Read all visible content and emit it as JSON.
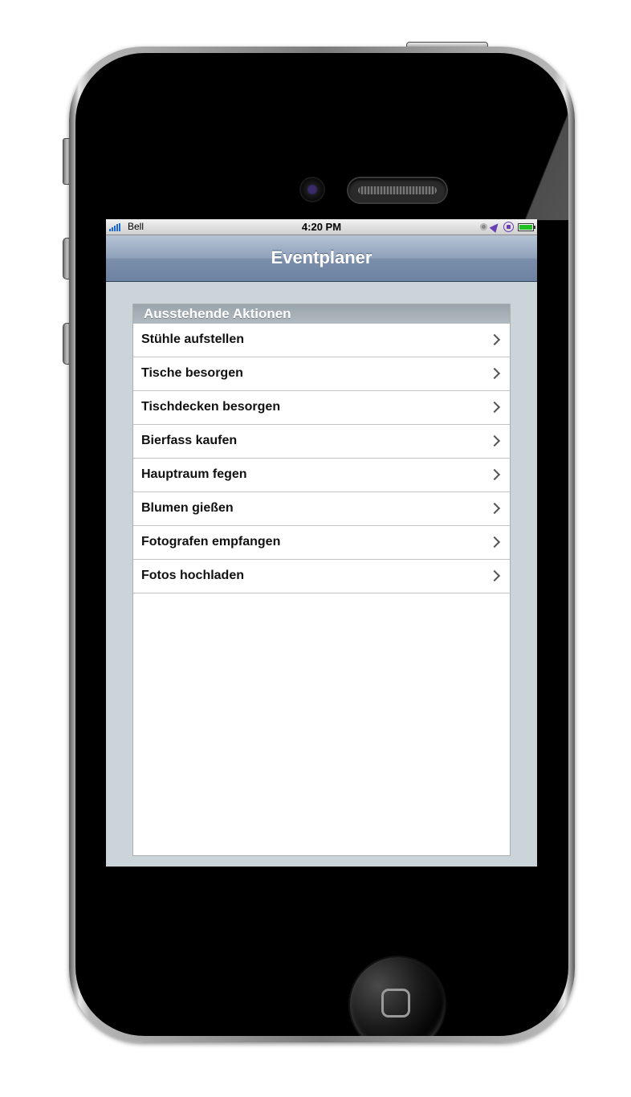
{
  "status_bar": {
    "carrier": "Bell",
    "time": "4:20 PM",
    "icons": [
      "signal-icon",
      "alarm-icon",
      "location-icon",
      "rotation-lock-icon",
      "battery-icon"
    ]
  },
  "nav": {
    "title": "Eventplaner"
  },
  "list": {
    "section_header": "Ausstehende Aktionen",
    "items": [
      {
        "label": "Stühle aufstellen"
      },
      {
        "label": "Tische besorgen"
      },
      {
        "label": "Tischdecken besorgen"
      },
      {
        "label": "Bierfass kaufen"
      },
      {
        "label": "Hauptraum fegen"
      },
      {
        "label": "Blumen gießen"
      },
      {
        "label": "Fotografen empfangen"
      },
      {
        "label": "Fotos hochladen"
      }
    ]
  },
  "colors": {
    "nav_bar": "#7b8fab",
    "screen_background": "#cbd5d9",
    "section_header": "#9aa4ab",
    "signal": "#1c6ad6",
    "battery": "#1fc01f",
    "location": "#6b3fb4"
  }
}
